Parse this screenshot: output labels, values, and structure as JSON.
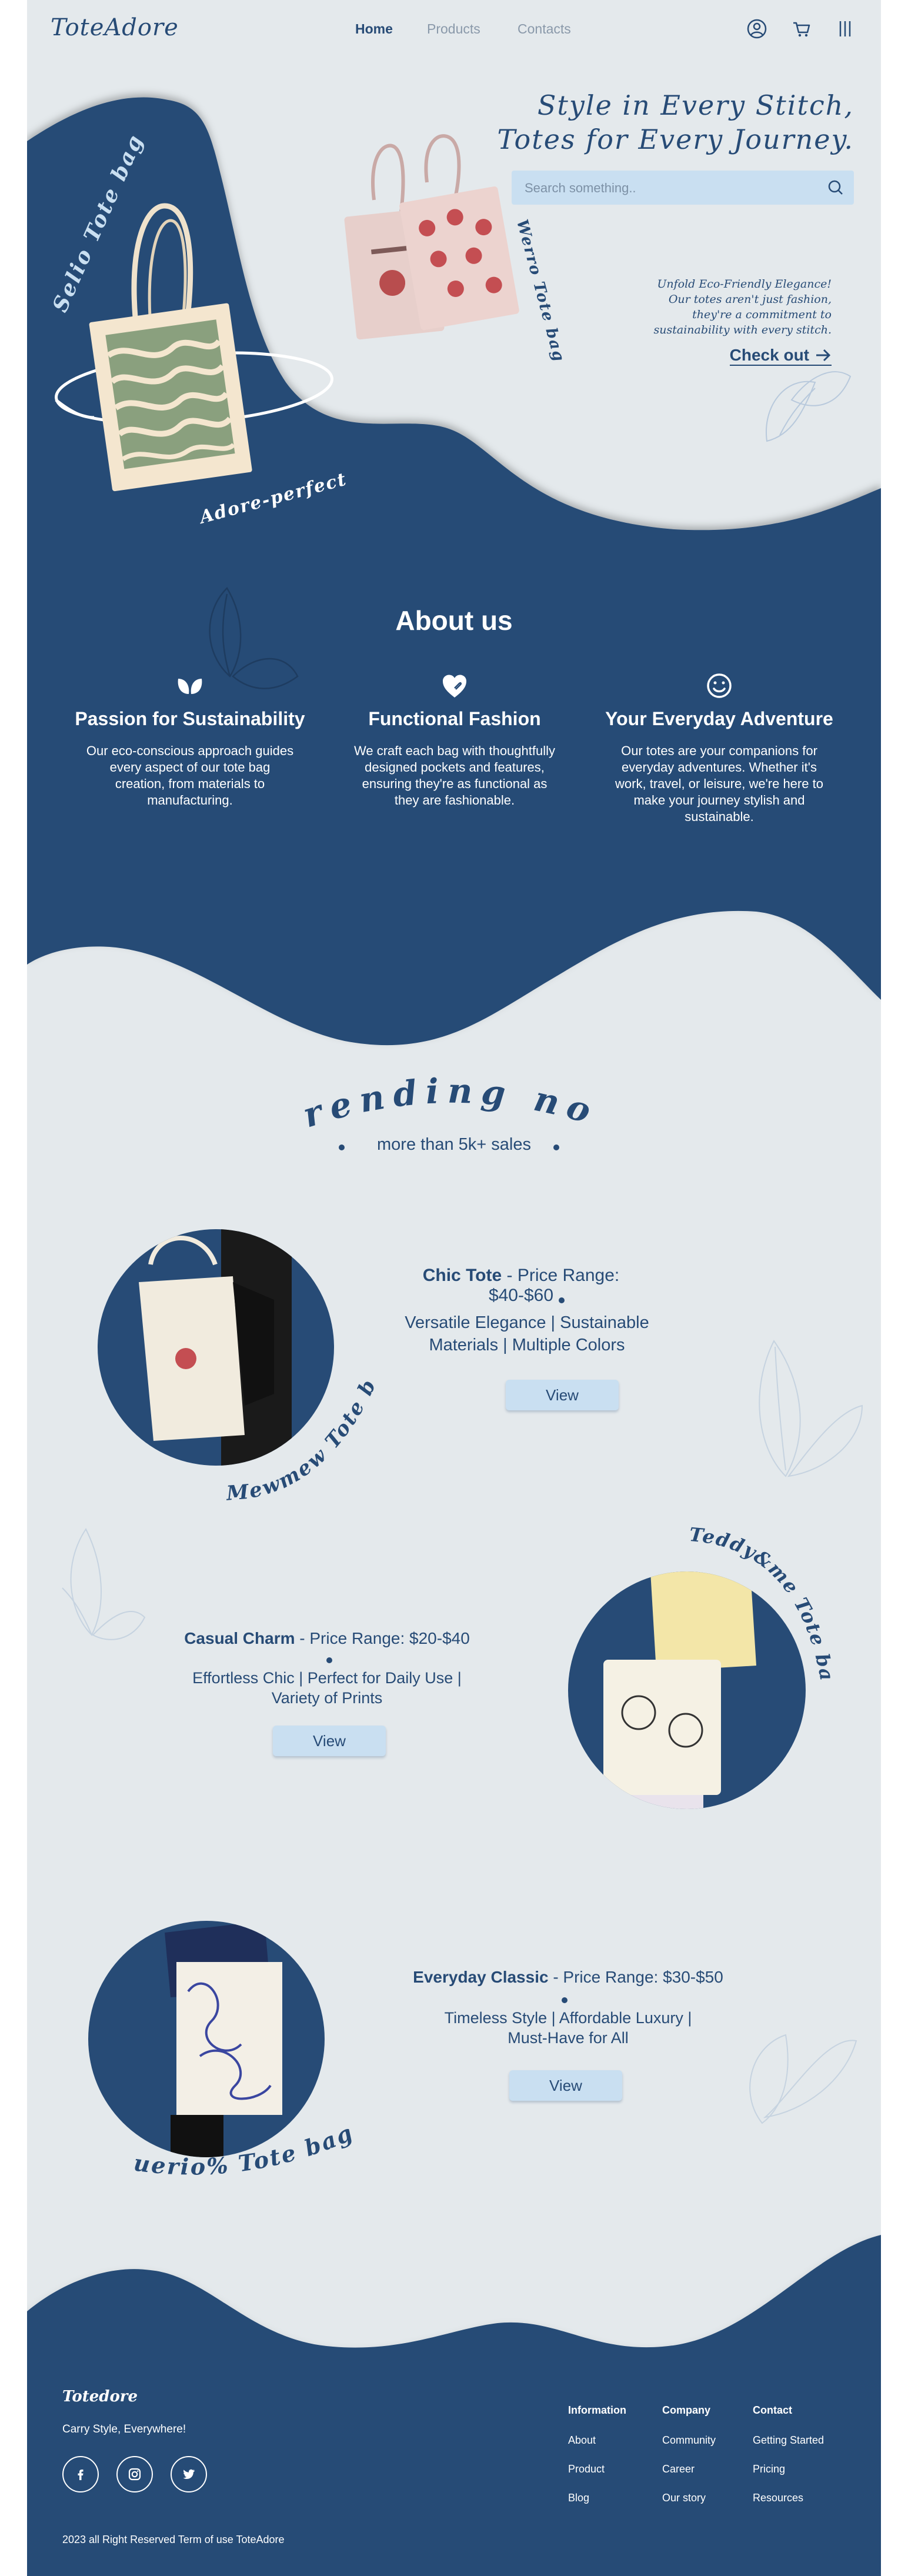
{
  "header": {
    "logo": "ToteAdore",
    "nav": [
      "Home",
      "Products",
      "Contacts"
    ],
    "icons": [
      "user-icon",
      "cart-icon",
      "menu-icon"
    ]
  },
  "hero": {
    "title_line1": "Style in Every Stitch,",
    "title_line2": "Totes for Every Journey.",
    "search_placeholder": "Search something..",
    "tagline_line1": "Unfold Eco-Friendly Elegance!",
    "tagline_line2": "Our totes aren't just fashion,",
    "tagline_line3": "they're a commitment to",
    "tagline_line4": "sustainability with every stitch.",
    "checkout": "Check out",
    "label_left": "Selio Tote bag",
    "label_adore": "Adore-perfect",
    "label_right": "Werro Tote bag"
  },
  "about": {
    "title": "About us",
    "features": [
      {
        "icon": "leaves-icon",
        "title": "Passion for Sustainability",
        "text": "Our eco-conscious approach guides every aspect of our tote bag creation, from materials to manufacturing."
      },
      {
        "icon": "heart-hand-icon",
        "title": "Functional Fashion",
        "text": "We craft each bag with thoughtfully designed pockets and features, ensuring they're as functional as they are fashionable."
      },
      {
        "icon": "smiley-icon",
        "title": "Your Everyday Adventure",
        "text": "Our totes are your companions for everyday adventures. Whether it's work, travel, or leisure, we're here to make your journey stylish and sustainable."
      }
    ]
  },
  "trending": {
    "title": "Trending now",
    "subtitle": "more than 5k+ sales",
    "products": [
      {
        "name": "Chic Tote",
        "price": " - Price Range: $40-$60",
        "desc_line1": "Versatile Elegance | Sustainable",
        "desc_line2": "Materials | Multiple Colors",
        "button": "View",
        "curve_label": "Mewmew Tote bag"
      },
      {
        "name": "Casual Charm",
        "price": " - Price Range: $20-$40",
        "desc_line1": "Effortless Chic | Perfect for Daily Use |",
        "desc_line2": "Variety of Prints",
        "button": "View",
        "curve_label": "Teddy&me Tote bag"
      },
      {
        "name": "Everyday Classic",
        "price": " - Price Range: $30-$50",
        "desc_line1": "Timeless Style | Affordable Luxury |",
        "desc_line2": "Must-Have for All",
        "button": "View",
        "curve_label": "uerio% Tote bag"
      }
    ]
  },
  "footer": {
    "brand": "Totedore",
    "slogan": "Carry Style, Everywhere!",
    "social": [
      "facebook-icon",
      "instagram-icon",
      "twitter-icon"
    ],
    "copyright": "2023 all Right Reserved Term of use ToteAdore",
    "columns": [
      {
        "heading": "Information",
        "links": [
          "About",
          "Product",
          "Blog"
        ]
      },
      {
        "heading": "Company",
        "links": [
          "Community",
          "Career",
          "Our story"
        ]
      },
      {
        "heading": "Contact",
        "links": [
          "Getting Started",
          "Pricing",
          "Resources"
        ]
      }
    ]
  },
  "colors": {
    "navy": "#274b76",
    "background": "#e4e9ec",
    "button": "#c9dff1"
  }
}
